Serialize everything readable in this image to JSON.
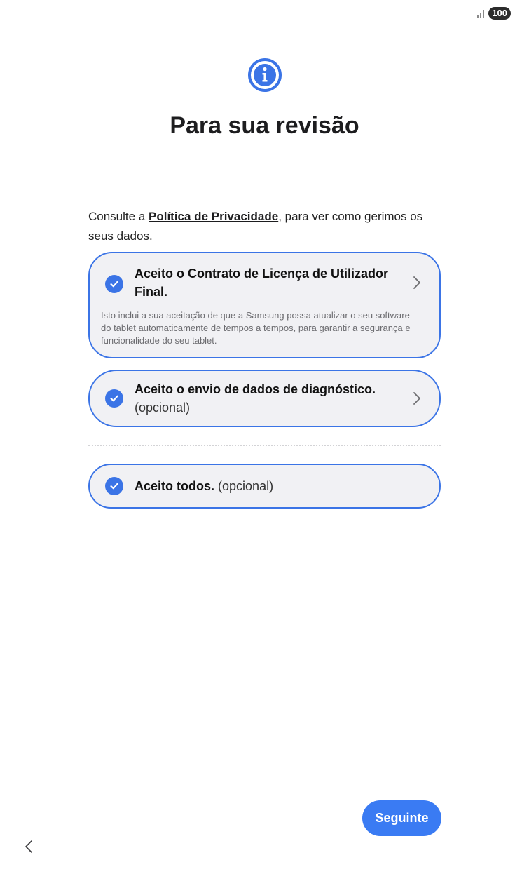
{
  "status_bar": {
    "battery": "100"
  },
  "header": {
    "title": "Para sua revisão"
  },
  "intro": {
    "prefix": "Consulte a ",
    "link": "Política de Privacidade",
    "suffix": ", para ver como gerimos os seus dados."
  },
  "items": [
    {
      "title": "Aceito o Contrato de Licença de Utilizador Final.",
      "description": "Isto inclui a sua aceitação de que a Samsung possa atualizar o seu software do tablet automaticamente de tempos a tempos, para garantir a segurança e funcionalidade do seu tablet.",
      "checked": true
    },
    {
      "title": "Aceito o envio de dados de diagnóstico.",
      "subtitle": "(opcional)",
      "checked": true
    }
  ],
  "accept_all": {
    "title": "Aceito todos.",
    "suffix": "(opcional)",
    "checked": true
  },
  "footer": {
    "next_label": "Seguinte"
  },
  "colors": {
    "accent": "#3b74e6",
    "card_bg": "#f1f1f4",
    "button": "#3a7bf3"
  }
}
